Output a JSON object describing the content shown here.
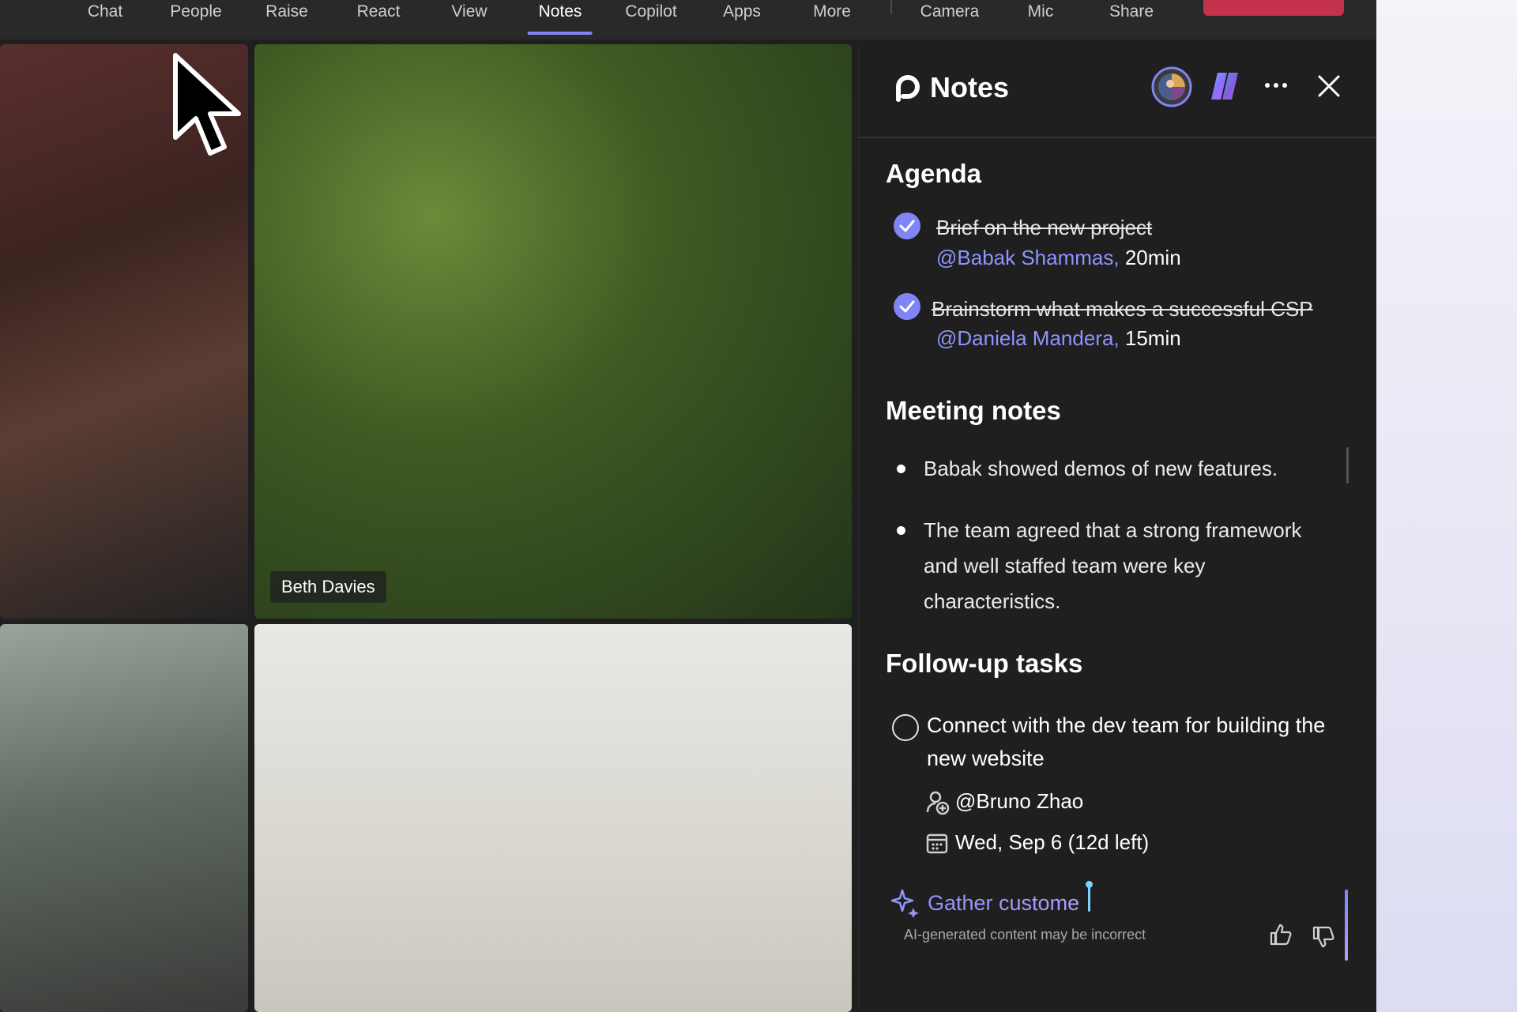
{
  "toolbar": {
    "items": [
      {
        "label": "Chat",
        "active": false
      },
      {
        "label": "People",
        "active": false
      },
      {
        "label": "Raise",
        "active": false
      },
      {
        "label": "React",
        "active": false
      },
      {
        "label": "View",
        "active": false
      },
      {
        "label": "Notes",
        "active": true
      },
      {
        "label": "Copilot",
        "active": false
      },
      {
        "label": "Apps",
        "active": false
      },
      {
        "label": "More",
        "active": false
      },
      {
        "label": "Camera",
        "active": false
      },
      {
        "label": "Mic",
        "active": false
      },
      {
        "label": "Share",
        "active": false
      }
    ],
    "leave_color": "#c4314b",
    "accent": "#7f85f5"
  },
  "video": {
    "participant_name": "Beth Davies"
  },
  "notes_panel": {
    "title": "Notes",
    "agenda": {
      "title": "Agenda",
      "items": [
        {
          "text": "Brief on the new project",
          "mention": "@Babak Shammas,",
          "duration": "20min",
          "done": true
        },
        {
          "text": "Brainstorm what makes a successful CSP",
          "mention": "@Daniela Mandera,",
          "duration": "15min",
          "done": true
        }
      ]
    },
    "meeting_notes": {
      "title": "Meeting notes",
      "bullets": [
        "Babak showed demos of new features.",
        "The team agreed that a strong framework and well staffed team were key characteristics."
      ]
    },
    "follow_up": {
      "title": "Follow-up tasks",
      "task": "Connect with the dev team for building the new website",
      "assignee": "@Bruno Zhao",
      "due": "Wed, Sep 6 (12d left)"
    },
    "ai": {
      "generating_text": "Gather custome",
      "disclaimer": "AI-generated content may be incorrect"
    },
    "mention_color": "#8f94ff"
  }
}
